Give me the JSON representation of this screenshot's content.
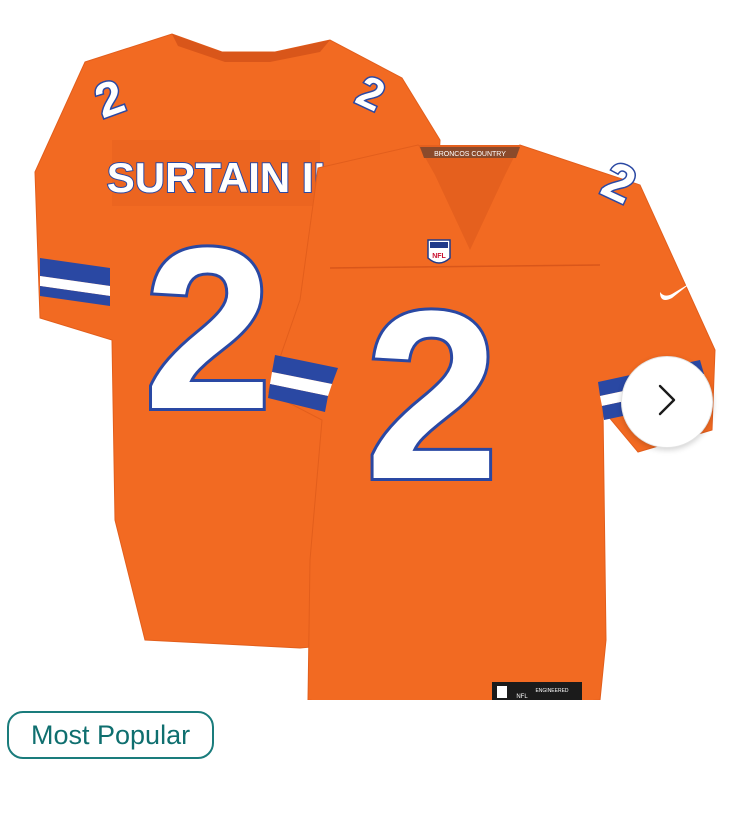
{
  "product": {
    "player_name": "SURTAIN II",
    "jersey_number": "2",
    "collar_tag": "BRONCOS COUNTRY",
    "shield_text": "NFL",
    "hem_tag_text": "ENGINEERED",
    "hem_tag_nfl": "NFL",
    "colors": {
      "jersey_orange": "#f26a22",
      "jersey_shadow": "#d9561a",
      "number_fill": "#ffffff",
      "number_outline": "#2a48a3",
      "stripe_blue": "#2a48a3",
      "stripe_white": "#ffffff"
    }
  },
  "carousel": {
    "next_icon": "chevron-right-icon"
  },
  "badge": {
    "label": "Most Popular",
    "color": "#1a7c7c"
  }
}
